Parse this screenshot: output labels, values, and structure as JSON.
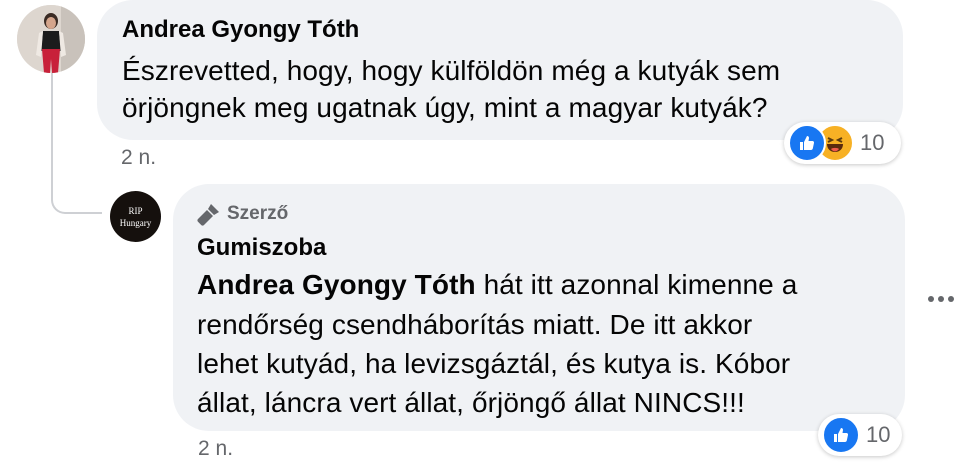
{
  "comment1": {
    "author": "Andrea Gyongy Tóth",
    "text_line1": "Észrevetted, hogy, hogy külföldön még a kutyák sem",
    "text_line2": "örjöngnek meg ugatnak úgy, mint a magyar kutyák?",
    "time": "2 n.",
    "reaction_count": "10",
    "reaction_icons": [
      "like-icon",
      "haha-icon"
    ]
  },
  "reply1": {
    "badge_label": "Szerző",
    "author": "Gumiszoba",
    "avatar_text_line1": "RIP",
    "avatar_text_line2": "Hungary",
    "mention": "Andrea Gyongy Tóth",
    "text_line1_rest": " hát itt azonnal kimenne a",
    "text_line2": "rendőrség csendháborítás miatt. De itt akkor",
    "text_line3": "lehet kutyád, ha levizsgáztál, és kutya is. Kóbor",
    "text_line4": "állat, láncra vert állat, őrjöngő állat NINCS!!!",
    "time": "2 n.",
    "reaction_count": "10",
    "reaction_icons": [
      "like-icon"
    ]
  },
  "colors": {
    "bubble_bg": "#f0f2f5",
    "secondary_text": "#65676b",
    "like_blue": "#1877f2",
    "haha_yellow": "#f7b125"
  }
}
